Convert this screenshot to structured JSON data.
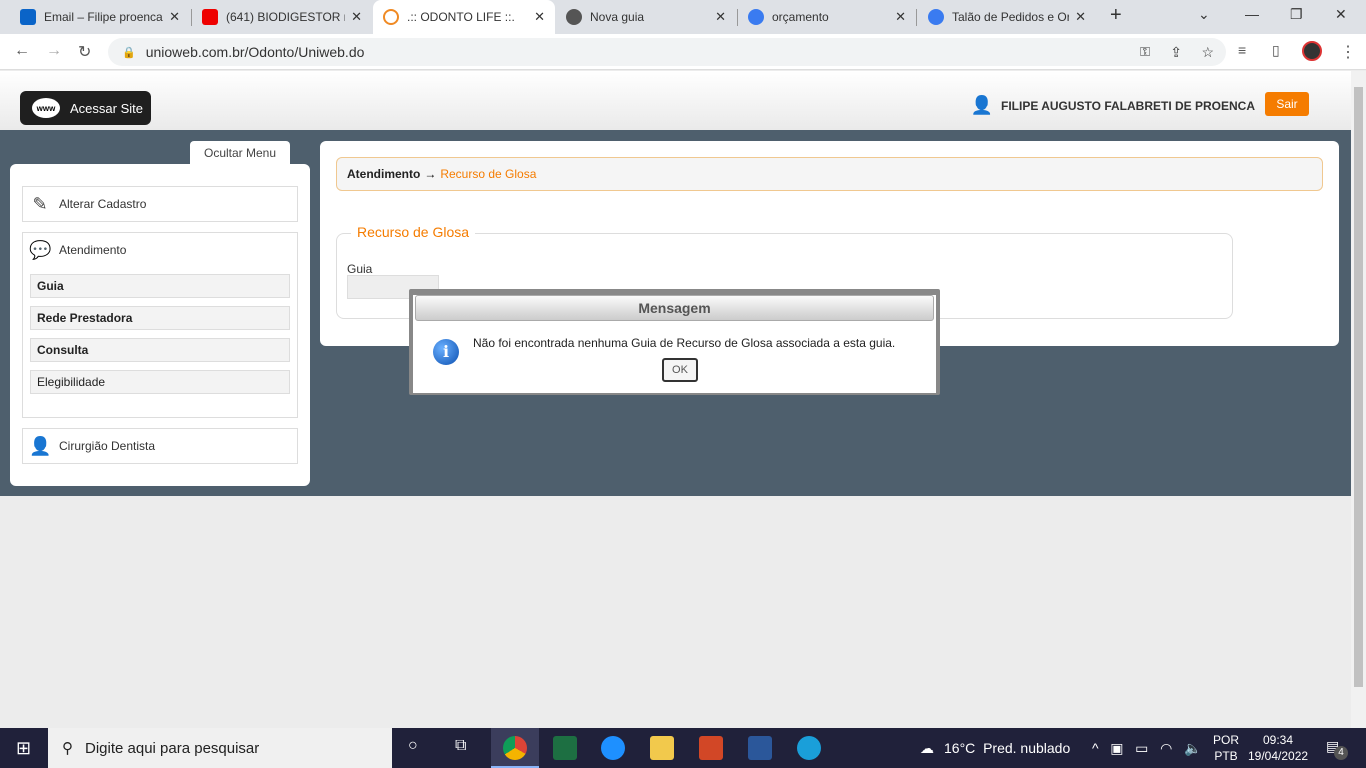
{
  "browser": {
    "tabs": [
      {
        "label": "Email – Filipe proenca",
        "color": "#0a64c8"
      },
      {
        "label": "(641) BIODIGESTOR m",
        "color": "#e00"
      },
      {
        "label": ".:: ODONTO LIFE ::.",
        "color": "#f08a24"
      },
      {
        "label": "Nova guia",
        "color": "#555"
      },
      {
        "label": "orçamento",
        "color": "#3a7bf0"
      },
      {
        "label": "Talão de Pedidos e Or",
        "color": "#3a7bf0"
      }
    ],
    "new_tab": "+",
    "url": "unioweb.com.br/Odonto/Uniweb.do"
  },
  "header": {
    "site_button": "Acessar Site",
    "www": "www",
    "user": "FILIPE AUGUSTO FALABRETI DE PROENCA",
    "logout": "Sair"
  },
  "sidebar": {
    "toggle": "Ocultar Menu",
    "alterar": "Alterar Cadastro",
    "atendimento": "Atendimento",
    "sub": [
      "Guia",
      "Rede Prestadora",
      "Consulta",
      "Elegibilidade"
    ],
    "cirurgiao": "Cirurgião Dentista"
  },
  "main": {
    "breadcrumb_root": "Atendimento",
    "breadcrumb_arrow": "→",
    "breadcrumb_current": "Recurso de Glosa",
    "fieldset": "Recurso de Glosa",
    "guia_label": "Guia"
  },
  "dialog": {
    "title": "Mensagem",
    "message": "Não foi encontrada nenhuma Guia de Recurso de Glosa associada a esta guia.",
    "ok": "OK"
  },
  "taskbar": {
    "search": "Digite aqui para pesquisar",
    "temp": "16°C",
    "weather": "Pred. nublado",
    "lang1": "POR",
    "lang2": "PTB",
    "time": "09:34",
    "date": "19/04/2022",
    "notifications": "4"
  }
}
